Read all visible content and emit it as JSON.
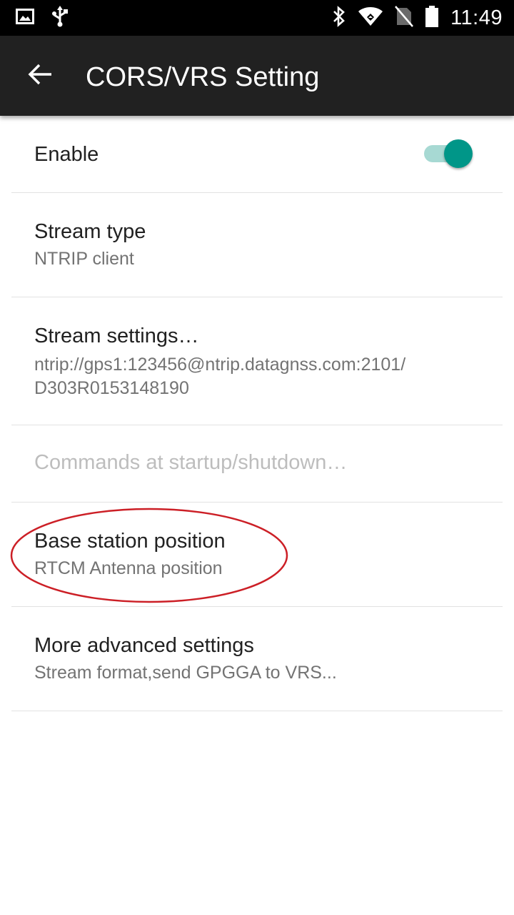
{
  "status_bar": {
    "time": "11:49",
    "icons": [
      "image-icon",
      "usb-icon",
      "bluetooth-icon",
      "wifi-icon",
      "no-sim-icon",
      "battery-icon"
    ]
  },
  "app_bar": {
    "title": "CORS/VRS Setting",
    "back_icon": "arrow-back-icon",
    "background": "#212121"
  },
  "settings": {
    "enable": {
      "title": "Enable",
      "checked": true,
      "accent": "#009688"
    },
    "stream_type": {
      "title": "Stream type",
      "summary": "NTRIP client"
    },
    "stream_settings": {
      "title": "Stream settings…",
      "summary_line1": "ntrip://gps1:123456@ntrip.datagnss.com:2101/",
      "summary_line2": "D303R0153148190"
    },
    "commands": {
      "title": "Commands at startup/shutdown…",
      "enabled": false
    },
    "base_station": {
      "title": "Base station position",
      "summary": "RTCM Antenna position",
      "annotation_color": "#cc1f26"
    },
    "more_advanced": {
      "title": "More advanced settings",
      "summary": "Stream format,send GPGGA to VRS..."
    }
  }
}
